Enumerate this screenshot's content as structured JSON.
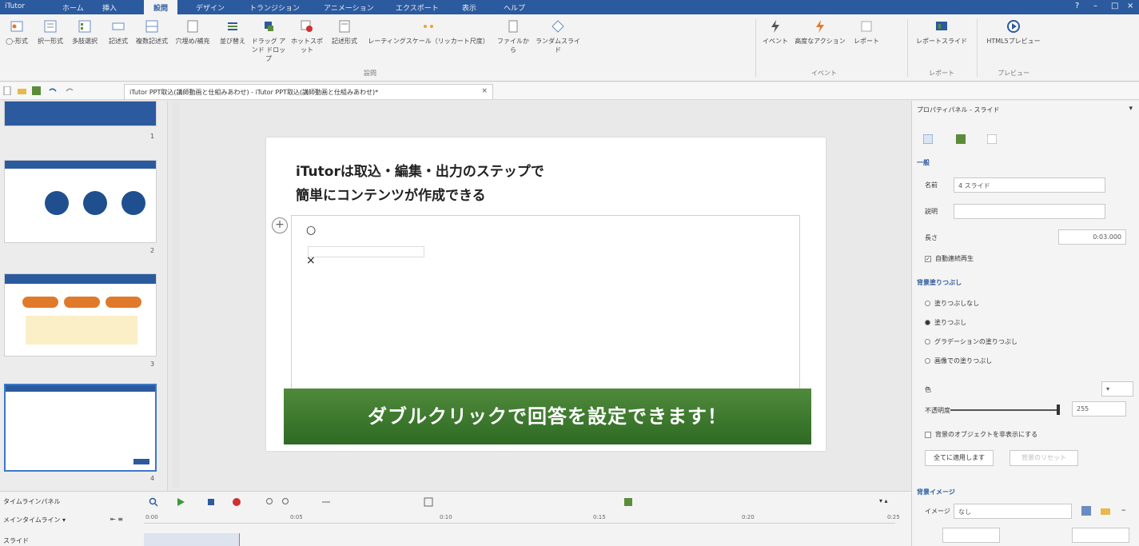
{
  "ribbon_tabs": [
    "iTutor",
    "ホーム",
    "挿入",
    "設問",
    "デザイン",
    "トランジション",
    "アニメーション",
    "エクスポート",
    "表示",
    "ヘルプ"
  ],
  "active_tab_index": 3,
  "ribbon_buttons": [
    {
      "label": "◯-形式",
      "icon": "circle-form-icon"
    },
    {
      "label": "択一形式",
      "icon": "single-choice-icon"
    },
    {
      "label": "多肢選択",
      "icon": "multi-choice-icon"
    },
    {
      "label": "記述式",
      "icon": "text-entry-icon"
    },
    {
      "label": "複数記述式",
      "icon": "multi-text-icon"
    },
    {
      "label": "穴埋め/補充",
      "icon": "fill-blank-icon"
    },
    {
      "label": "並び替え",
      "icon": "sequence-icon"
    },
    {
      "label": "ドラッグ アンド ドロップ",
      "icon": "drag-drop-icon"
    },
    {
      "label": "ホットスポット",
      "icon": "hotspot-icon"
    },
    {
      "label": "記述形式",
      "icon": "essay-icon"
    },
    {
      "label": "レーティングスケール（リッカート尺度）",
      "icon": "rating-scale-icon"
    },
    {
      "label": "ファイルから",
      "icon": "from-file-icon"
    },
    {
      "label": "ランダムスライド",
      "icon": "random-slide-icon"
    },
    {
      "label": "イベント",
      "icon": "event-icon"
    },
    {
      "label": "高度なアクション",
      "icon": "advanced-action-icon"
    },
    {
      "label": "レポート",
      "icon": "report-icon"
    },
    {
      "label": "レポートスライド",
      "icon": "report-slide-icon"
    },
    {
      "label": "HTML5プレビュー",
      "icon": "preview-icon"
    }
  ],
  "ribbon_groups": {
    "question": "設問",
    "event": "イベント",
    "report": "レポート",
    "preview": "プレビュー"
  },
  "document_tab": "iTutor PPT取込(講師動画と仕組みあわせ) - iTutor PPT取込(講師動画と仕組みあわせ)*",
  "slide_numbers": [
    "1",
    "2",
    "3",
    "4"
  ],
  "slide": {
    "title_line1": "iTutorは取込・編集・出力のステップで",
    "title_line2": "簡単にコンテンツが作成できる",
    "answer_button": "ダブルクリックで回答を設定できます！"
  },
  "properties": {
    "panel_title": "プロパティパネル - スライド",
    "section_general": "一般",
    "name_label": "名前",
    "name_value": "4 スライド",
    "desc_label": "説明",
    "duration_label": "長さ",
    "duration_value": "0:03.000",
    "autoplay_label": "自動連続再生",
    "section_fill": "背景塗りつぶし",
    "fill_options": [
      "塗りつぶしなし",
      "塗りつぶし",
      "グラデーションの塗りつぶし",
      "画像での塗りつぶし"
    ],
    "fill_selected_index": 1,
    "color_label": "色",
    "transparency_label": "不透明度",
    "transparency_value": "255",
    "hide_objects_label": "背景のオブジェクトを非表示にする",
    "apply_all_button": "全てに適用します",
    "reset_button": "背景のリセット",
    "section_image": "背景イメージ",
    "image_label": "イメージ",
    "image_value": "なし"
  },
  "timeline": {
    "panel_title": "タイムラインパネル",
    "main_timeline": "メインタイムライン",
    "track_label": "スライド",
    "ruler": [
      "0:00",
      "0:05",
      "0:10",
      "0:15",
      "0:20",
      "0:25"
    ]
  },
  "colors": {
    "ribbon_blue": "#2b5a9e",
    "answer_green": "#3f7a30",
    "accent_red": "#d03030"
  }
}
